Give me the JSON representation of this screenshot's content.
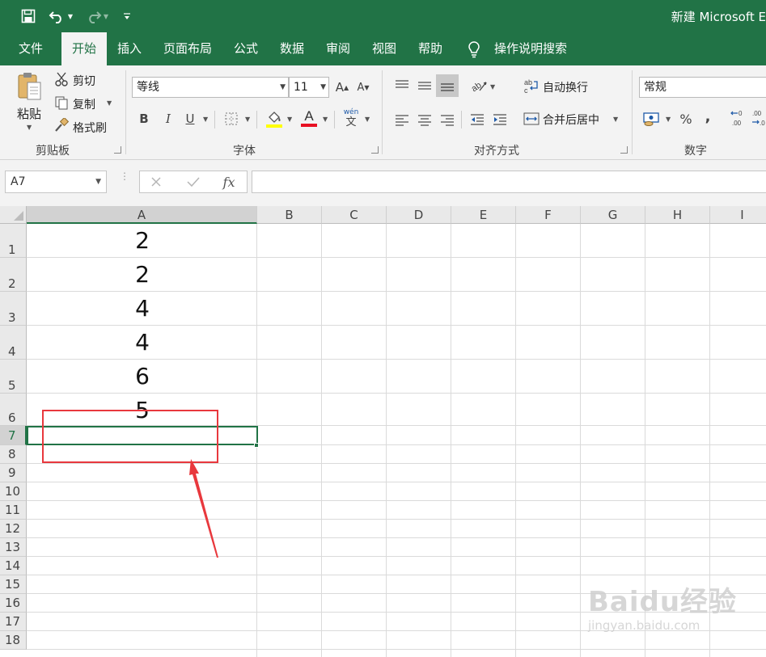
{
  "app": {
    "title": "新建 Microsoft E"
  },
  "quick_access": {
    "icons": [
      "save-icon",
      "undo-icon",
      "redo-icon",
      "customize-icon"
    ]
  },
  "tabs": [
    {
      "label": "文件"
    },
    {
      "label": "开始"
    },
    {
      "label": "插入"
    },
    {
      "label": "页面布局"
    },
    {
      "label": "公式"
    },
    {
      "label": "数据"
    },
    {
      "label": "审阅"
    },
    {
      "label": "视图"
    },
    {
      "label": "帮助"
    },
    {
      "label": "操作说明搜索"
    }
  ],
  "active_tab": "开始",
  "ribbon": {
    "clipboard": {
      "paste": "粘贴",
      "cut": "剪切",
      "copy": "复制",
      "format_painter": "格式刷",
      "group": "剪贴板"
    },
    "font": {
      "name": "等线",
      "size": "11",
      "bold": "B",
      "italic": "I",
      "underline": "U",
      "pinyin": "wén",
      "pinyin_char": "文",
      "group": "字体",
      "fill_color": "#ffff00",
      "font_color": "#e81123"
    },
    "alignment": {
      "wrap_text": "自动换行",
      "merge_center": "合并后居中",
      "group": "对齐方式"
    },
    "number": {
      "format": "常规",
      "percent": "%",
      "comma": ",",
      "group": "数字"
    }
  },
  "formula_bar": {
    "name_box": "A7",
    "fx": "fx",
    "formula": ""
  },
  "sheet": {
    "columns": [
      "A",
      "B",
      "C",
      "D",
      "E",
      "F",
      "G",
      "H",
      "I"
    ],
    "rows": [
      "1",
      "2",
      "3",
      "4",
      "5",
      "6",
      "7",
      "8",
      "9",
      "10",
      "11",
      "12",
      "13",
      "14",
      "15",
      "16",
      "17",
      "18"
    ],
    "column_a_values": [
      "2",
      "2",
      "4",
      "4",
      "6",
      "5"
    ],
    "selected_cell": "A7"
  },
  "annotation_color": "#e8383d",
  "watermark": {
    "brand": "Baidu经验",
    "url": "jingyan.baidu.com"
  }
}
